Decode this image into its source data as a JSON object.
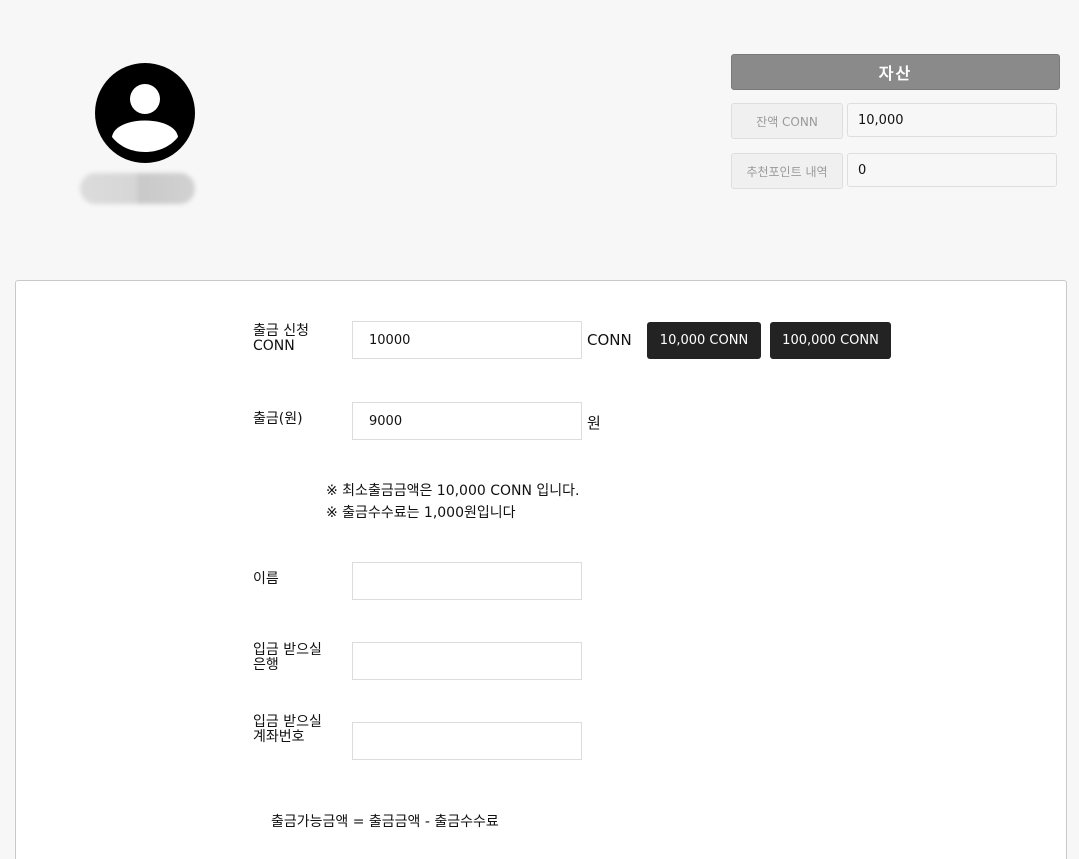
{
  "profile": {
    "avatar_icon": "user-circle-icon"
  },
  "assets": {
    "title": "자산",
    "rows": [
      {
        "label": "잔액 CONN",
        "value": "10,000"
      },
      {
        "label": "추천포인트 내역",
        "value": "0"
      }
    ]
  },
  "withdraw": {
    "conn_label": "출금 신청 CONN",
    "conn_value": "10000",
    "conn_unit": "CONN",
    "quick_buttons": [
      "10,000 CONN",
      "100,000 CONN"
    ],
    "won_label": "출금(원)",
    "won_value": "9000",
    "won_unit": "원",
    "notices": [
      "※ 최소출금금액은 10,000 CONN 입니다.",
      "※ 출금수수료는 1,000원입니다"
    ],
    "name_label": "이름",
    "name_value": "",
    "bank_label": "입금 받으실 은행",
    "bank_value": "",
    "account_label": "입금 받으실 계좌번호",
    "account_value": "",
    "formula": "출금가능금액 = 출금금액 - 출금수수료"
  }
}
